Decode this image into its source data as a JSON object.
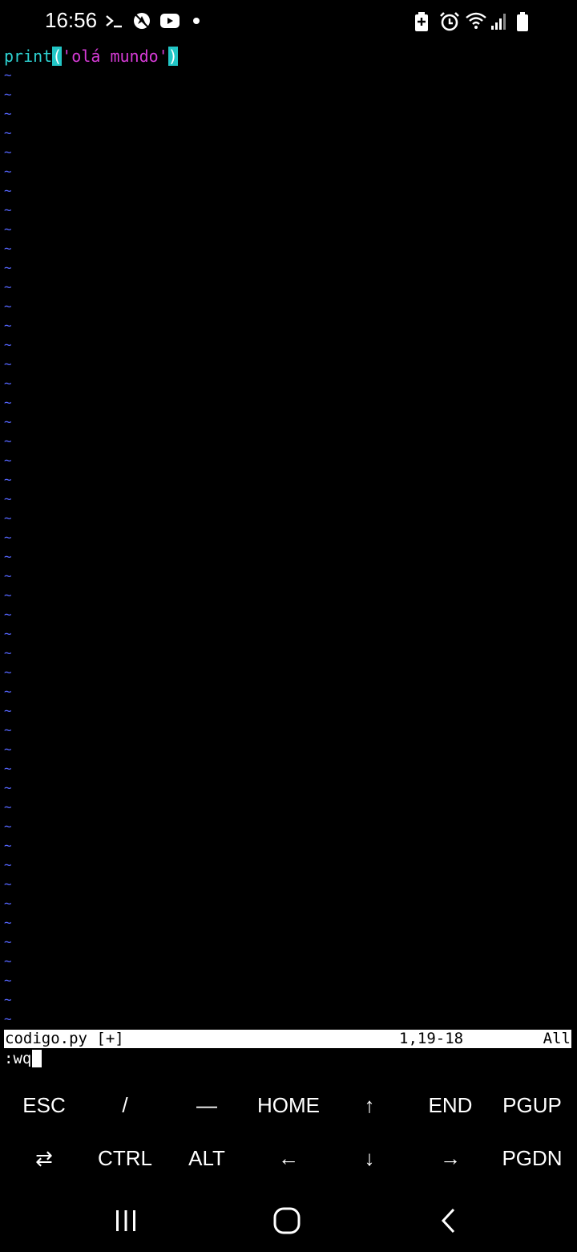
{
  "status_bar": {
    "time": "16:56",
    "left_icons": [
      "terminal-icon",
      "location-off-icon",
      "youtube-icon",
      "notification-dot-icon"
    ],
    "right_icons": [
      "battery-saver-icon",
      "alarm-icon",
      "wifi-icon",
      "signal-icon",
      "battery-icon"
    ]
  },
  "editor": {
    "code": {
      "func": "print",
      "open_paren": "(",
      "string": "'olá mundo'",
      "close_paren": ")"
    },
    "tilde": "~",
    "statusline": {
      "filename": "codigo.py [+]",
      "position": "1,19-18",
      "scroll": "All"
    },
    "command": ":wq"
  },
  "extra_keys": {
    "row1": [
      "ESC",
      "/",
      "—",
      "HOME",
      "↑",
      "END",
      "PGUP"
    ],
    "row2": [
      "⇄",
      "CTRL",
      "ALT",
      "←",
      "↓",
      "→",
      "PGDN"
    ]
  },
  "nav_bar": {
    "buttons": [
      "recent-apps-icon",
      "home-icon",
      "back-icon"
    ]
  },
  "colors": {
    "keyword": "#2ed3d3",
    "string": "#d63bd6",
    "tilde": "#5566ff",
    "background": "#000000"
  }
}
